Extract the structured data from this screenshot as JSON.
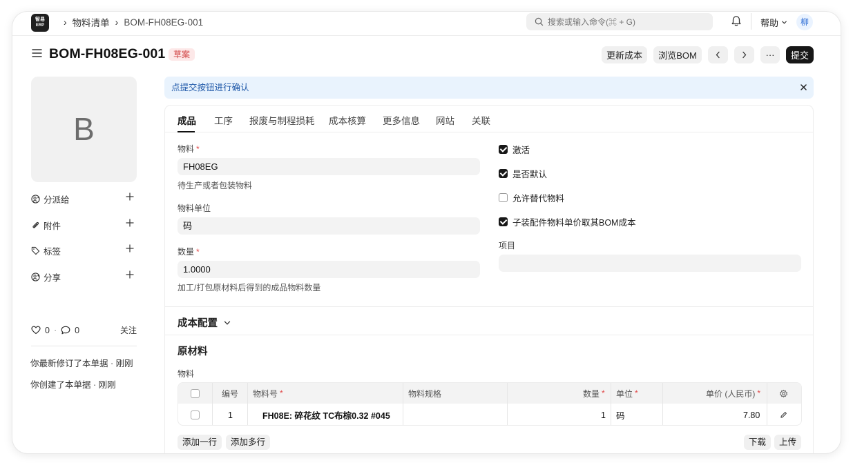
{
  "navbar": {
    "logo_line1": "智易",
    "logo_line2": "ERP",
    "breadcrumbs": [
      "物料清单",
      "BOM-FH08EG-001"
    ],
    "search_placeholder": "搜索或输入命令(⌘ + G)",
    "help_label": "帮助",
    "avatar_initial": "柳"
  },
  "header": {
    "title": "BOM-FH08EG-001",
    "status": "草案",
    "buttons": {
      "update_cost": "更新成本",
      "browse_bom": "浏览BOM",
      "more": "···",
      "submit": "提交"
    }
  },
  "sidebar": {
    "image_initial": "B",
    "actions": [
      {
        "label": "分派给",
        "icon": "assign-icon"
      },
      {
        "label": "附件",
        "icon": "paperclip-icon"
      },
      {
        "label": "标签",
        "icon": "tag-icon"
      },
      {
        "label": "分享",
        "icon": "share-icon"
      }
    ],
    "likes": "0",
    "comments": "0",
    "dot": "·",
    "follow": "关注",
    "activity": [
      "你最新修订了本单据 · 刚刚",
      "你创建了本单据 · 刚刚"
    ]
  },
  "alert": {
    "message": "点提交按钮进行确认"
  },
  "tabs": [
    "成品",
    "工序",
    "报废与制程损耗",
    "成本核算",
    "更多信息",
    "网站",
    "关联"
  ],
  "form": {
    "item_label": "物料",
    "item_value": "FH08EG",
    "item_help": "待生产或者包装物料",
    "uom_label": "物料单位",
    "uom_value": "码",
    "qty_label": "数量",
    "qty_value": "1.0000",
    "qty_help": "加工/打包原材料后得到的成品物料数量",
    "required_mark": "*",
    "checkboxes": [
      {
        "label": "激活",
        "checked": true
      },
      {
        "label": "是否默认",
        "checked": true
      },
      {
        "label": "允许替代物料",
        "checked": false
      },
      {
        "label": "子装配件物料单价取其BOM成本",
        "checked": true
      }
    ],
    "project_label": "项目",
    "project_value": ""
  },
  "sections": {
    "cost_config": "成本配置",
    "raw_materials": "原材料",
    "items_label": "物料"
  },
  "items_table": {
    "headers": {
      "no": "编号",
      "item_code": "物料号",
      "spec": "物料规格",
      "qty": "数量",
      "uom": "单位",
      "rate": "单价 (人民币)"
    },
    "rows": [
      {
        "no": "1",
        "item_code": "FH08E: 碎花纹 TC布棕0.32 #045",
        "spec": "",
        "qty": "1",
        "uom": "码",
        "rate": "7.80"
      }
    ],
    "buttons": {
      "add_row": "添加一行",
      "add_multiple": "添加多行",
      "download": "下载",
      "upload": "上传"
    }
  }
}
